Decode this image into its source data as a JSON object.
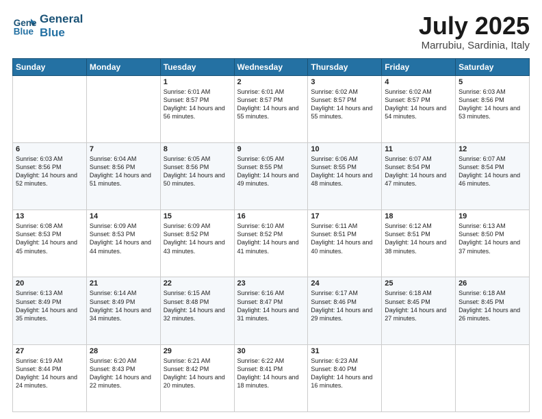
{
  "header": {
    "logo_line1": "General",
    "logo_line2": "Blue",
    "title": "July 2025",
    "subtitle": "Marrubiu, Sardinia, Italy"
  },
  "weekdays": [
    "Sunday",
    "Monday",
    "Tuesday",
    "Wednesday",
    "Thursday",
    "Friday",
    "Saturday"
  ],
  "weeks": [
    [
      {
        "day": "",
        "content": ""
      },
      {
        "day": "",
        "content": ""
      },
      {
        "day": "1",
        "content": "Sunrise: 6:01 AM\nSunset: 8:57 PM\nDaylight: 14 hours and 56 minutes."
      },
      {
        "day": "2",
        "content": "Sunrise: 6:01 AM\nSunset: 8:57 PM\nDaylight: 14 hours and 55 minutes."
      },
      {
        "day": "3",
        "content": "Sunrise: 6:02 AM\nSunset: 8:57 PM\nDaylight: 14 hours and 55 minutes."
      },
      {
        "day": "4",
        "content": "Sunrise: 6:02 AM\nSunset: 8:57 PM\nDaylight: 14 hours and 54 minutes."
      },
      {
        "day": "5",
        "content": "Sunrise: 6:03 AM\nSunset: 8:56 PM\nDaylight: 14 hours and 53 minutes."
      }
    ],
    [
      {
        "day": "6",
        "content": "Sunrise: 6:03 AM\nSunset: 8:56 PM\nDaylight: 14 hours and 52 minutes."
      },
      {
        "day": "7",
        "content": "Sunrise: 6:04 AM\nSunset: 8:56 PM\nDaylight: 14 hours and 51 minutes."
      },
      {
        "day": "8",
        "content": "Sunrise: 6:05 AM\nSunset: 8:56 PM\nDaylight: 14 hours and 50 minutes."
      },
      {
        "day": "9",
        "content": "Sunrise: 6:05 AM\nSunset: 8:55 PM\nDaylight: 14 hours and 49 minutes."
      },
      {
        "day": "10",
        "content": "Sunrise: 6:06 AM\nSunset: 8:55 PM\nDaylight: 14 hours and 48 minutes."
      },
      {
        "day": "11",
        "content": "Sunrise: 6:07 AM\nSunset: 8:54 PM\nDaylight: 14 hours and 47 minutes."
      },
      {
        "day": "12",
        "content": "Sunrise: 6:07 AM\nSunset: 8:54 PM\nDaylight: 14 hours and 46 minutes."
      }
    ],
    [
      {
        "day": "13",
        "content": "Sunrise: 6:08 AM\nSunset: 8:53 PM\nDaylight: 14 hours and 45 minutes."
      },
      {
        "day": "14",
        "content": "Sunrise: 6:09 AM\nSunset: 8:53 PM\nDaylight: 14 hours and 44 minutes."
      },
      {
        "day": "15",
        "content": "Sunrise: 6:09 AM\nSunset: 8:52 PM\nDaylight: 14 hours and 43 minutes."
      },
      {
        "day": "16",
        "content": "Sunrise: 6:10 AM\nSunset: 8:52 PM\nDaylight: 14 hours and 41 minutes."
      },
      {
        "day": "17",
        "content": "Sunrise: 6:11 AM\nSunset: 8:51 PM\nDaylight: 14 hours and 40 minutes."
      },
      {
        "day": "18",
        "content": "Sunrise: 6:12 AM\nSunset: 8:51 PM\nDaylight: 14 hours and 38 minutes."
      },
      {
        "day": "19",
        "content": "Sunrise: 6:13 AM\nSunset: 8:50 PM\nDaylight: 14 hours and 37 minutes."
      }
    ],
    [
      {
        "day": "20",
        "content": "Sunrise: 6:13 AM\nSunset: 8:49 PM\nDaylight: 14 hours and 35 minutes."
      },
      {
        "day": "21",
        "content": "Sunrise: 6:14 AM\nSunset: 8:49 PM\nDaylight: 14 hours and 34 minutes."
      },
      {
        "day": "22",
        "content": "Sunrise: 6:15 AM\nSunset: 8:48 PM\nDaylight: 14 hours and 32 minutes."
      },
      {
        "day": "23",
        "content": "Sunrise: 6:16 AM\nSunset: 8:47 PM\nDaylight: 14 hours and 31 minutes."
      },
      {
        "day": "24",
        "content": "Sunrise: 6:17 AM\nSunset: 8:46 PM\nDaylight: 14 hours and 29 minutes."
      },
      {
        "day": "25",
        "content": "Sunrise: 6:18 AM\nSunset: 8:45 PM\nDaylight: 14 hours and 27 minutes."
      },
      {
        "day": "26",
        "content": "Sunrise: 6:18 AM\nSunset: 8:45 PM\nDaylight: 14 hours and 26 minutes."
      }
    ],
    [
      {
        "day": "27",
        "content": "Sunrise: 6:19 AM\nSunset: 8:44 PM\nDaylight: 14 hours and 24 minutes."
      },
      {
        "day": "28",
        "content": "Sunrise: 6:20 AM\nSunset: 8:43 PM\nDaylight: 14 hours and 22 minutes."
      },
      {
        "day": "29",
        "content": "Sunrise: 6:21 AM\nSunset: 8:42 PM\nDaylight: 14 hours and 20 minutes."
      },
      {
        "day": "30",
        "content": "Sunrise: 6:22 AM\nSunset: 8:41 PM\nDaylight: 14 hours and 18 minutes."
      },
      {
        "day": "31",
        "content": "Sunrise: 6:23 AM\nSunset: 8:40 PM\nDaylight: 14 hours and 16 minutes."
      },
      {
        "day": "",
        "content": ""
      },
      {
        "day": "",
        "content": ""
      }
    ]
  ]
}
